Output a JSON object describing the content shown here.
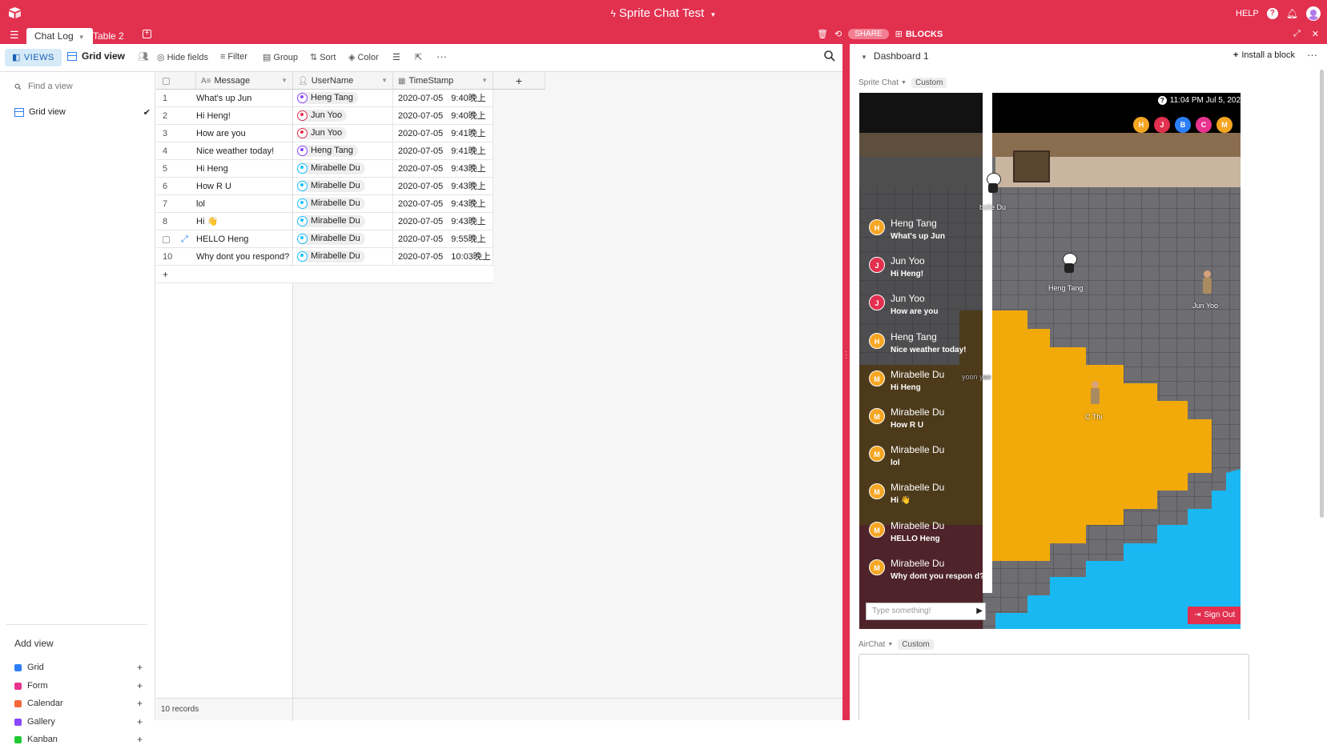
{
  "app": {
    "title": "Sprite Chat Test",
    "help": "HELP",
    "share": "SHARE",
    "blocks": "BLOCKS",
    "brand_color": "#e2304f"
  },
  "tabs": [
    {
      "label": "Chat Log",
      "active": true
    },
    {
      "label": "Table 2",
      "active": false
    }
  ],
  "toolbar": {
    "views": "VIEWS",
    "grid_view": "Grid view",
    "hide_fields": "Hide fields",
    "filter": "Filter",
    "group": "Group",
    "sort": "Sort",
    "color": "Color"
  },
  "sidebar": {
    "find_placeholder": "Find a view",
    "current_view": "Grid view",
    "add_view": "Add view",
    "view_types": [
      {
        "label": "Grid",
        "color": "#2d7ff9"
      },
      {
        "label": "Form",
        "color": "#e8338f"
      },
      {
        "label": "Calendar",
        "color": "#f2683a"
      },
      {
        "label": "Gallery",
        "color": "#8b46ff"
      },
      {
        "label": "Kanban",
        "color": "#20c933"
      }
    ]
  },
  "grid": {
    "columns": [
      "Message",
      "UserName",
      "TimeStamp"
    ],
    "rows": [
      {
        "n": "1",
        "message": "What's up Jun",
        "user": "Heng Tang",
        "user_color": "#8b46ff",
        "date": "2020-07-05",
        "time": "9:40晚上"
      },
      {
        "n": "2",
        "message": "Hi Heng!",
        "user": "Jun Yoo",
        "user_color": "#e2304f",
        "date": "2020-07-05",
        "time": "9:40晚上"
      },
      {
        "n": "3",
        "message": "How are you",
        "user": "Jun Yoo",
        "user_color": "#e2304f",
        "date": "2020-07-05",
        "time": "9:41晚上"
      },
      {
        "n": "4",
        "message": "Nice weather today!",
        "user": "Heng Tang",
        "user_color": "#8b46ff",
        "date": "2020-07-05",
        "time": "9:41晚上"
      },
      {
        "n": "5",
        "message": "Hi Heng",
        "user": "Mirabelle Du",
        "user_color": "#18bfff",
        "date": "2020-07-05",
        "time": "9:43晚上"
      },
      {
        "n": "6",
        "message": "How R U",
        "user": "Mirabelle Du",
        "user_color": "#18bfff",
        "date": "2020-07-05",
        "time": "9:43晚上"
      },
      {
        "n": "7",
        "message": "lol",
        "user": "Mirabelle Du",
        "user_color": "#18bfff",
        "date": "2020-07-05",
        "time": "9:43晚上"
      },
      {
        "n": "8",
        "message": "Hi 👋",
        "user": "Mirabelle Du",
        "user_color": "#18bfff",
        "date": "2020-07-05",
        "time": "9:43晚上"
      },
      {
        "n": "",
        "message": "HELLO Heng",
        "user": "Mirabelle Du",
        "user_color": "#18bfff",
        "date": "2020-07-05",
        "time": "9:55晚上"
      },
      {
        "n": "10",
        "message": "Why dont you respond?",
        "user": "Mirabelle Du",
        "user_color": "#18bfff",
        "date": "2020-07-05",
        "time": "10:03晚上"
      }
    ],
    "record_count": "10 records"
  },
  "dashboard": {
    "title": "Dashboard 1",
    "install": "Install a block",
    "block1_name": "Sprite Chat",
    "block2_name": "AirChat",
    "custom": "Custom"
  },
  "game": {
    "clock": "11:04 PM Jul 5, 202",
    "online": [
      {
        "letter": "H",
        "color": "#f5a623"
      },
      {
        "letter": "J",
        "color": "#e2304f"
      },
      {
        "letter": "B",
        "color": "#2d7ff9"
      },
      {
        "letter": "C",
        "color": "#e8338f"
      },
      {
        "letter": "M",
        "color": "#f5a623"
      }
    ],
    "chat": [
      {
        "letter": "H",
        "color": "#f5a623",
        "name": "Heng Tang",
        "text": "What's up Jun"
      },
      {
        "letter": "J",
        "color": "#e2304f",
        "name": "Jun Yoo",
        "text": "Hi Heng!"
      },
      {
        "letter": "J",
        "color": "#e2304f",
        "name": "Jun Yoo",
        "text": "How are you"
      },
      {
        "letter": "H",
        "color": "#f5a623",
        "name": "Heng Tang",
        "text": "Nice weather today!"
      },
      {
        "letter": "M",
        "color": "#f5a623",
        "name": "Mirabelle Du",
        "text": "Hi Heng"
      },
      {
        "letter": "M",
        "color": "#f5a623",
        "name": "Mirabelle Du",
        "text": "How R U"
      },
      {
        "letter": "M",
        "color": "#f5a623",
        "name": "Mirabelle Du",
        "text": "lol"
      },
      {
        "letter": "M",
        "color": "#f5a623",
        "name": "Mirabelle Du",
        "text": "Hi 👋"
      },
      {
        "letter": "M",
        "color": "#f5a623",
        "name": "Mirabelle Du",
        "text": "HELLO Heng"
      },
      {
        "letter": "M",
        "color": "#f5a623",
        "name": "Mirabelle Du",
        "text": "Why dont you respon d?"
      }
    ],
    "type_placeholder": "Type something!",
    "sign_out": "Sign Out",
    "sprites": {
      "mirabelle": "belle Du",
      "heng": "Heng Tang",
      "jun": "Jun Yoo",
      "cthi": "C Thi",
      "hidden": "yoon   yao"
    }
  }
}
